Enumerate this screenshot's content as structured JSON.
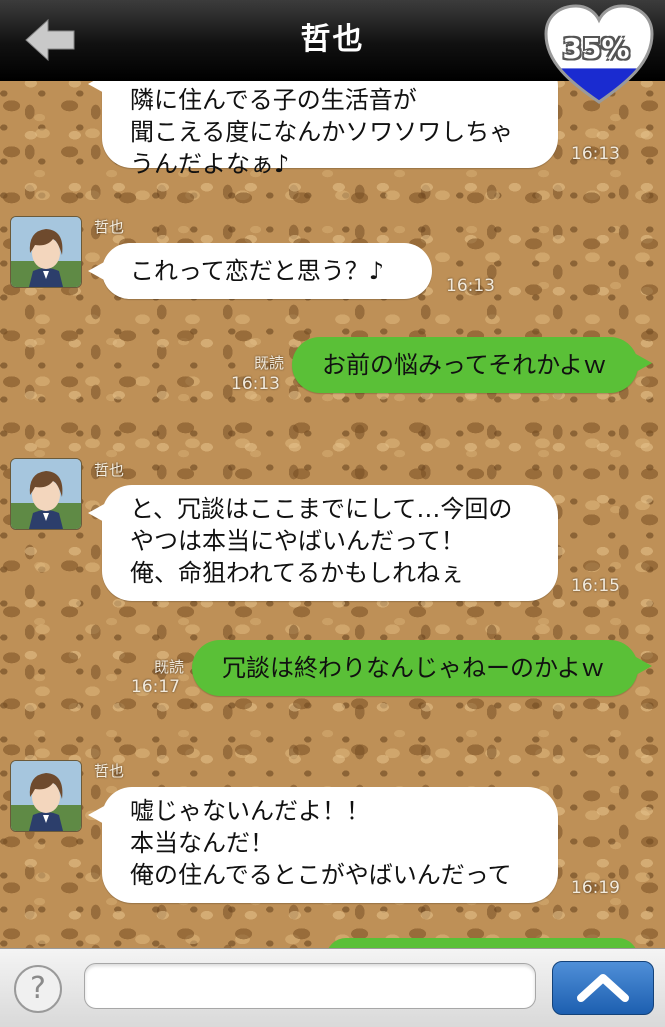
{
  "header": {
    "title": "哲也",
    "back_icon": "back-arrow-icon",
    "affection_percent": "35%",
    "affection_level": 0.35,
    "heart_icon": "heart-gauge-icon"
  },
  "messages": [
    {
      "side": "left",
      "sender": "",
      "text": "隣に住んでる子の生活音が\n聞こえる度になんかソワソワしちゃ\nうんだよなぁ♪",
      "time": "16:13",
      "read": ""
    },
    {
      "side": "left",
      "sender": "哲也",
      "text": "これって恋だと思う？♪",
      "time": "16:13",
      "read": ""
    },
    {
      "side": "right",
      "sender": "",
      "text": "お前の悩みってそれかよｗ",
      "time": "16:13",
      "read": "既読"
    },
    {
      "side": "left",
      "sender": "哲也",
      "text": "と、冗談はここまでにして…今回の\nやつは本当にやばいんだって！\n俺、命狙われてるかもしれねぇ",
      "time": "16:15",
      "read": ""
    },
    {
      "side": "right",
      "sender": "",
      "text": "冗談は終わりなんじゃねーのかよｗ",
      "time": "16:17",
      "read": "既読"
    },
    {
      "side": "left",
      "sender": "哲也",
      "text": "嘘じゃないんだよ！！\n本当なんだ！\n俺の住んでるとこがやばいんだって",
      "time": "16:19",
      "read": ""
    }
  ],
  "input": {
    "help_label": "?",
    "help_icon": "help-icon",
    "text_value": "",
    "send_icon": "chevron-up-icon"
  },
  "colors": {
    "outgoing_bubble": "#5ac037",
    "incoming_bubble": "#ffffff",
    "send_button": "#1d5fb0",
    "heart_fill": "#1a2bd0"
  }
}
